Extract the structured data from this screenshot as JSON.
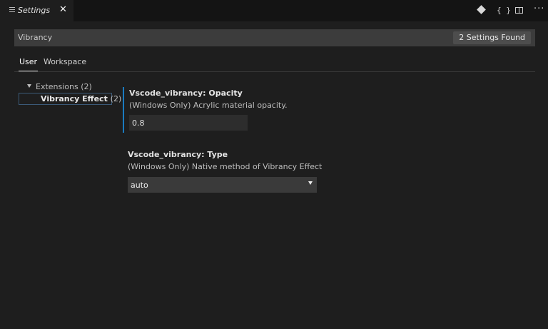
{
  "tab": {
    "title": "Settings",
    "close": "✕"
  },
  "actions": {
    "braces": "{ }",
    "more": "···"
  },
  "search": {
    "value": "Vibrancy",
    "result_badge": "2 Settings Found"
  },
  "scope_tabs": [
    {
      "label": "User"
    },
    {
      "label": "Workspace"
    }
  ],
  "tree": {
    "group": {
      "label": "Extensions",
      "count": "(2)"
    },
    "item": {
      "label": "Vibrancy Effect",
      "count": "(2)"
    }
  },
  "settings": [
    {
      "category": "Vscode_vibrancy:",
      "name": "Opacity",
      "description": "(Windows Only) Acrylic material opacity.",
      "value": "0.8"
    },
    {
      "category": "Vscode_vibrancy:",
      "name": "Type",
      "description": "(Windows Only) Native method of Vibrancy Effect",
      "value": "auto"
    }
  ]
}
